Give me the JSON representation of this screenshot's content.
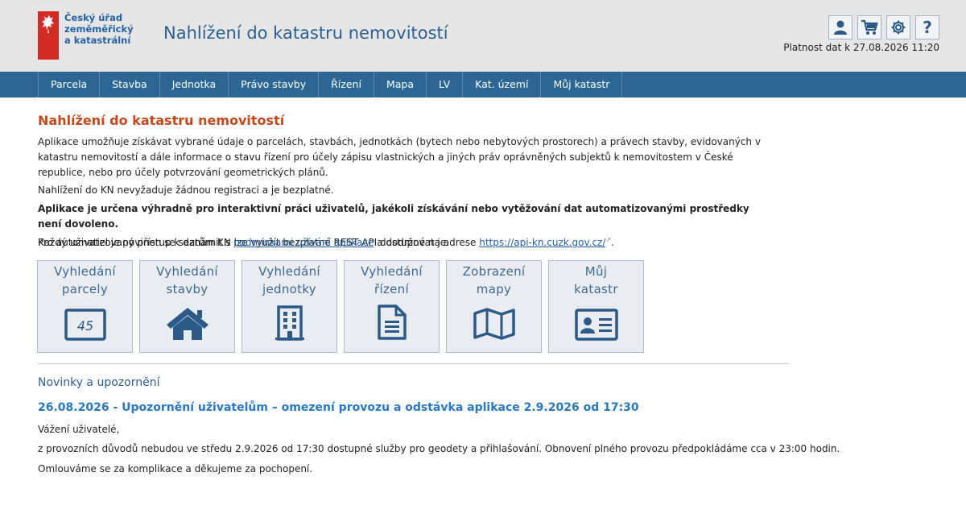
{
  "header": {
    "org_line1": "Český úřad",
    "org_line2": "zeměměřický",
    "org_line3": "a katastrální",
    "app_title": "Nahlížení do katastru nemovitostí",
    "validity": "Platnost dat k 27.08.2026 11:20",
    "tools": [
      "user-icon",
      "cart-icon",
      "gear-icon",
      "help-icon"
    ],
    "help_glyph": "?"
  },
  "nav": {
    "items": [
      "Parcela",
      "Stavba",
      "Jednotka",
      "Právo stavby",
      "Řízení",
      "Mapa",
      "LV",
      "Kat. území",
      "Můj katastr"
    ]
  },
  "main": {
    "title": "Nahlížení do katastru nemovitostí",
    "intro": "Aplikace umožňuje získávat vybrané údaje o parcelách, stavbách, jednotkách (bytech nebo nebytových prostorech) a právech stavby, evidovaných v katastru nemovitostí a dále informace o stavu řízení pro účely zápisu vlastnických a jiných práv oprávněných subjektů k nemovitostem v České republice, nebo pro účely potvrzování geometrických plánů.",
    "free_text": "Nahlížení do KN nevyžaduje žádnou registraci a je bezplatné.",
    "warning_bold": "Aplikace je určena výhradně pro interaktivní práci uživatelů, jakékoli získávání nebo vytěžování dat automatizovanými prostředky není dovoleno.",
    "api_prefix": "Pro automatizovaný přístup k datům KN lze využít bezplatné REST API dostupné na adrese ",
    "api_link": "https://api-kn.cuzk.gov.cz/",
    "api_suffix": ".",
    "terms_prefix": "Každý uživatel je povinen se seznámit s ",
    "terms_link": "podmínkami užívání aplikace",
    "terms_suffix": " a dodržovat je."
  },
  "tiles": [
    {
      "line1": "Vyhledání",
      "line2": "parcely",
      "icon": "parcel-number-icon",
      "badge": "45"
    },
    {
      "line1": "Vyhledání",
      "line2": "stavby",
      "icon": "house-icon"
    },
    {
      "line1": "Vyhledání",
      "line2": "jednotky",
      "icon": "building-icon"
    },
    {
      "line1": "Vyhledání",
      "line2": "řízení",
      "icon": "document-icon"
    },
    {
      "line1": "Zobrazení",
      "line2": "mapy",
      "icon": "map-icon"
    },
    {
      "line1": "Můj",
      "line2": "katastr",
      "icon": "id-card-icon"
    }
  ],
  "news": {
    "heading": "Novinky a upozornění",
    "title": "26.08.2026 - Upozornění uživatelům – omezení provozu a odstávka aplikace 2.9.2026 od 17:30",
    "greeting": "Vážení uživatelé,",
    "body": "z provozních důvodů nebudou ve středu 2.9.2026 od 17:30 dostupné služby pro geodety a přihlašování. Obnovení plného provozu předpokládáme cca v 23:00 hodin.",
    "closing": "Omlouváme se za komplikace a děkujeme za pochopení."
  },
  "colors": {
    "nav_bg": "#2c6694",
    "title_accent": "#c4481b",
    "link": "#2462a7",
    "logo_red": "#d42b24"
  }
}
